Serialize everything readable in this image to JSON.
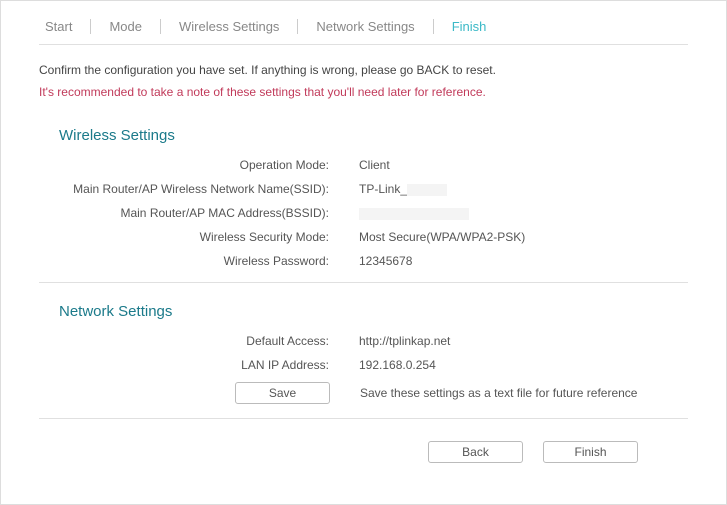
{
  "tabs": {
    "start": "Start",
    "mode": "Mode",
    "wireless": "Wireless Settings",
    "network": "Network Settings",
    "finish": "Finish"
  },
  "messages": {
    "confirm": "Confirm the configuration you have set. If anything is wrong, please go BACK to reset.",
    "recommend": "It's recommended to take a note of these settings that you'll need later for reference."
  },
  "wireless_section": {
    "title": "Wireless Settings",
    "labels": {
      "operation_mode": "Operation Mode:",
      "ssid": "Main Router/AP Wireless Network Name(SSID):",
      "bssid": "Main Router/AP MAC Address(BSSID):",
      "security_mode": "Wireless Security Mode:",
      "password": "Wireless Password:"
    },
    "values": {
      "operation_mode": "Client",
      "ssid": "TP-Link_",
      "bssid": "",
      "security_mode": "Most Secure(WPA/WPA2-PSK)",
      "password": "12345678"
    }
  },
  "network_section": {
    "title": "Network Settings",
    "labels": {
      "default_access": "Default Access:",
      "lan_ip": "LAN IP Address:"
    },
    "values": {
      "default_access": "http://tplinkap.net",
      "lan_ip": "192.168.0.254"
    },
    "save_button": "Save",
    "save_hint": "Save these settings as a text file for future reference"
  },
  "footer": {
    "back": "Back",
    "finish": "Finish"
  }
}
